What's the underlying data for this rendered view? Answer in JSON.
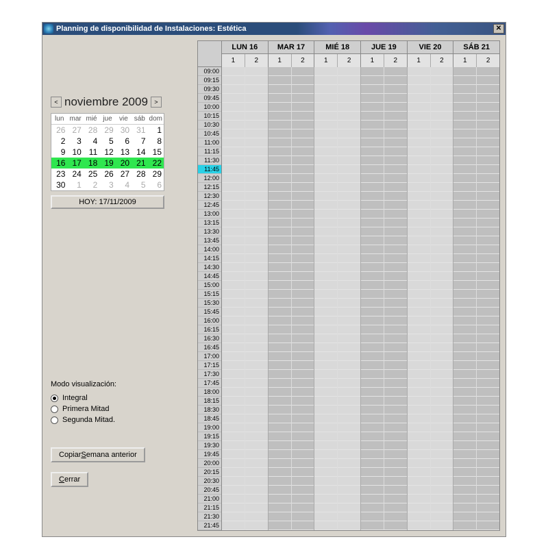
{
  "window": {
    "title": "Planning de disponibilidad de Instalaciones: Estética"
  },
  "calendar": {
    "month_label": "noviembre 2009",
    "weekday_headers": [
      "lun",
      "mar",
      "mié",
      "jue",
      "vie",
      "sáb",
      "dom"
    ],
    "weeks": [
      {
        "days": [
          {
            "n": "26",
            "g": true
          },
          {
            "n": "27",
            "g": true
          },
          {
            "n": "28",
            "g": true
          },
          {
            "n": "29",
            "g": true
          },
          {
            "n": "30",
            "g": true
          },
          {
            "n": "31",
            "g": true
          },
          {
            "n": "1"
          }
        ]
      },
      {
        "days": [
          {
            "n": "2"
          },
          {
            "n": "3"
          },
          {
            "n": "4"
          },
          {
            "n": "5"
          },
          {
            "n": "6"
          },
          {
            "n": "7"
          },
          {
            "n": "8"
          }
        ]
      },
      {
        "days": [
          {
            "n": "9"
          },
          {
            "n": "10"
          },
          {
            "n": "11"
          },
          {
            "n": "12"
          },
          {
            "n": "13"
          },
          {
            "n": "14"
          },
          {
            "n": "15"
          }
        ]
      },
      {
        "days": [
          {
            "n": "16"
          },
          {
            "n": "17"
          },
          {
            "n": "18"
          },
          {
            "n": "19"
          },
          {
            "n": "20"
          },
          {
            "n": "21"
          },
          {
            "n": "22"
          }
        ],
        "selected": true
      },
      {
        "days": [
          {
            "n": "23"
          },
          {
            "n": "24"
          },
          {
            "n": "25"
          },
          {
            "n": "26"
          },
          {
            "n": "27"
          },
          {
            "n": "28"
          },
          {
            "n": "29"
          }
        ]
      },
      {
        "days": [
          {
            "n": "30"
          },
          {
            "n": "1",
            "g": true
          },
          {
            "n": "2",
            "g": true
          },
          {
            "n": "3",
            "g": true
          },
          {
            "n": "4",
            "g": true
          },
          {
            "n": "5",
            "g": true
          },
          {
            "n": "6",
            "g": true
          }
        ]
      }
    ],
    "today_button": "HOY: 17/11/2009"
  },
  "mode": {
    "label": "Modo visualización:",
    "options": [
      "Integral",
      "Primera Mitad",
      "Segunda Mitad."
    ],
    "selected_index": 0
  },
  "buttons": {
    "copy_prev_week_pre": "Copiar ",
    "copy_prev_week_u": "S",
    "copy_prev_week_post": "emana anterior",
    "close_u": "C",
    "close_post": "errar"
  },
  "schedule": {
    "days": [
      {
        "label": "LUN  16"
      },
      {
        "label": "MAR  17"
      },
      {
        "label": "MIÉ  18"
      },
      {
        "label": "JUE  19"
      },
      {
        "label": "VIE  20"
      },
      {
        "label": "SÁB  21"
      }
    ],
    "subcols": [
      "1",
      "2"
    ],
    "time_slots": [
      "09:00",
      "09:15",
      "09:30",
      "09:45",
      "10:00",
      "10:15",
      "10:30",
      "10:45",
      "11:00",
      "11:15",
      "11:30",
      "11:45",
      "12:00",
      "12:15",
      "12:30",
      "12:45",
      "13:00",
      "13:15",
      "13:30",
      "13:45",
      "14:00",
      "14:15",
      "14:30",
      "14:45",
      "15:00",
      "15:15",
      "15:30",
      "15:45",
      "16:00",
      "16:15",
      "16:30",
      "16:45",
      "17:00",
      "17:15",
      "17:30",
      "17:45",
      "18:00",
      "18:15",
      "18:30",
      "18:45",
      "19:00",
      "19:15",
      "19:30",
      "19:45",
      "20:00",
      "20:15",
      "20:30",
      "20:45",
      "21:00",
      "21:15",
      "21:30",
      "21:45"
    ],
    "cursor_slot": "11:45"
  }
}
